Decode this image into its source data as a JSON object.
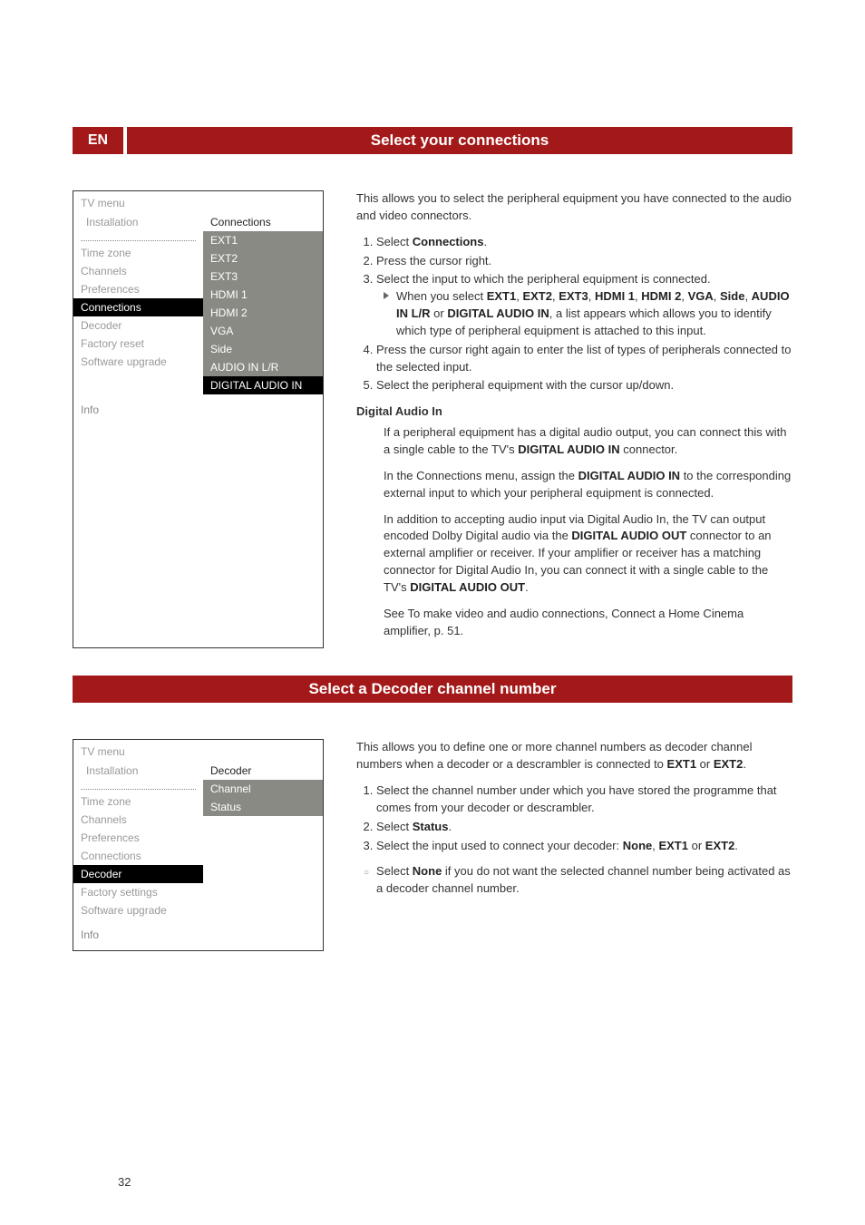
{
  "header": {
    "lang": "EN",
    "title1": "Select your connections",
    "title2": "Select a Decoder channel number"
  },
  "menu1": {
    "title": "TV menu",
    "leftHeader": "Installation",
    "rightHeader": "Connections",
    "left": [
      "Time zone",
      "Channels",
      "Preferences",
      "Connections",
      "Decoder",
      "Factory reset",
      "Software upgrade"
    ],
    "leftSelectedIdx": 3,
    "right": [
      "EXT1",
      "EXT2",
      "EXT3",
      "HDMI 1",
      "HDMI 2",
      "VGA",
      "Side",
      "AUDIO IN L/R",
      "DIGITAL AUDIO IN"
    ],
    "rightSelectedIdx": 8,
    "info": "Info"
  },
  "menu2": {
    "title": "TV menu",
    "leftHeader": "Installation",
    "rightHeader": "Decoder",
    "left": [
      "Time zone",
      "Channels",
      "Preferences",
      "Connections",
      "Decoder",
      "Factory settings",
      "Software upgrade"
    ],
    "leftSelectedIdx": 4,
    "right": [
      "Channel",
      "Status",
      "",
      "",
      "",
      "",
      ""
    ],
    "info": "Info"
  },
  "body1": {
    "intro": "This allows you to select the peripheral equipment you have connected to the audio and video connectors.",
    "step1": "Select <b>Connections</b>.",
    "step2": "Press the cursor right.",
    "step3": "Select the input to which the peripheral equipment is connected.",
    "step3sub": "When you select <b>EXT1</b>, <b>EXT2</b>, <b>EXT3</b>, <b>HDMI 1</b>, <b>HDMI 2</b>, <b>VGA</b>, <b>Side</b>, <b>AUDIO IN L/R</b> or <b>DIGITAL AUDIO IN</b>, a list appears which allows you to identify which type of peripheral equipment is attached to this input.",
    "step4": "Press the cursor right again to enter the list of types of peripherals connected to the selected input.",
    "step5": "Select the peripheral equipment with the cursor up/down.",
    "digTitle": "Digital Audio In",
    "digP1": "If a peripheral equipment has a digital audio output, you can connect this with a single cable to the TV's <b>DIGITAL AUDIO IN</b> connector.",
    "digP2": "In the Connections menu, assign the <b>DIGITAL AUDIO IN</b> to the corresponding external input to which your peripheral equipment is connected.",
    "digP3": "In addition to accepting audio input via Digital Audio In, the TV can output encoded Dolby Digital audio via the <b>DIGITAL AUDIO OUT</b> connector to an external amplifier or receiver. If your amplifier or receiver has a matching connector for Digital Audio In, you can connect it with a single cable to the TV's <b>DIGITAL AUDIO OUT</b>.",
    "digP4": "See To make video and audio connections, Connect a Home Cinema amplifier, p. 51."
  },
  "body2": {
    "intro": "This allows you to define one or more channel numbers as decoder channel numbers when a decoder or a descrambler is connected to <b>EXT1</b> or <b>EXT2</b>.",
    "step1": "Select the channel number under which you have stored the programme that comes from your decoder or descrambler.",
    "step2": "Select <b>Status</b>.",
    "step3": "Select the input used to connect your decoder: <b>None</b>, <b>EXT1</b> or <b>EXT2</b>.",
    "note": "Select <b>None</b> if you do not want the selected channel number being activated as a decoder channel number."
  },
  "pageNum": "32"
}
